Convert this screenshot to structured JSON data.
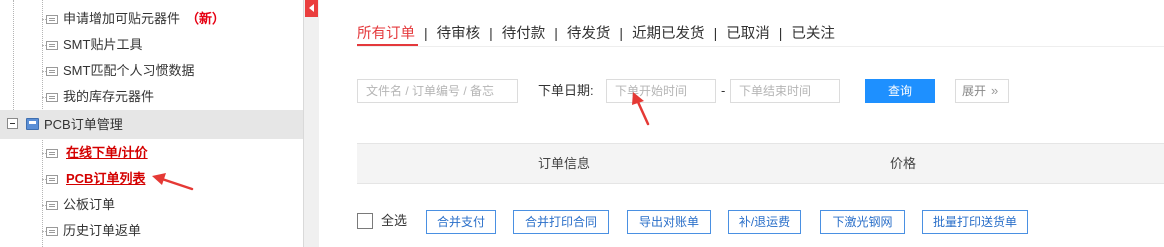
{
  "sidebar": {
    "items": [
      {
        "label": "申请增加可贴元器件",
        "badge": "（新）",
        "style": "normal"
      },
      {
        "label": "SMT贴片工具",
        "style": "normal"
      },
      {
        "label": "SMT匹配个人习惯数据",
        "style": "normal"
      },
      {
        "label": "我的库存元器件",
        "style": "normal"
      }
    ],
    "group": {
      "label": "PCB订单管理"
    },
    "sub_items": [
      {
        "label": "在线下单/计价",
        "style": "highlight"
      },
      {
        "label": "PCB订单列表",
        "style": "highlight"
      },
      {
        "label": "公板订单",
        "style": "normal"
      },
      {
        "label": "历史订单返单",
        "style": "normal"
      }
    ]
  },
  "tabs": [
    {
      "label": "所有订单",
      "active": true
    },
    {
      "label": "待审核",
      "active": false
    },
    {
      "label": "待付款",
      "active": false
    },
    {
      "label": "待发货",
      "active": false
    },
    {
      "label": "近期已发货",
      "active": false
    },
    {
      "label": "已取消",
      "active": false
    },
    {
      "label": "已关注",
      "active": false
    }
  ],
  "tab_separator": "|",
  "filters": {
    "keyword_placeholder": "文件名 / 订单编号 / 备忘",
    "date_label": "下单日期:",
    "start_placeholder": "下单开始时间",
    "date_dash": "-",
    "end_placeholder": "下单结束时间",
    "query_label": "查询",
    "expand_label": "展开",
    "expand_icon": "»"
  },
  "table": {
    "columns": [
      "订单信息",
      "价格"
    ]
  },
  "actions": {
    "select_all_label": "全选",
    "buttons": [
      "合并支付",
      "合并打印合同",
      "导出对账单",
      "补/退运费",
      "下激光钢网",
      "批量打印送货单"
    ]
  },
  "colors": {
    "accent": "#e4393c",
    "primary_button": "#1e90ff",
    "annotation_arrow": "#e53935"
  }
}
